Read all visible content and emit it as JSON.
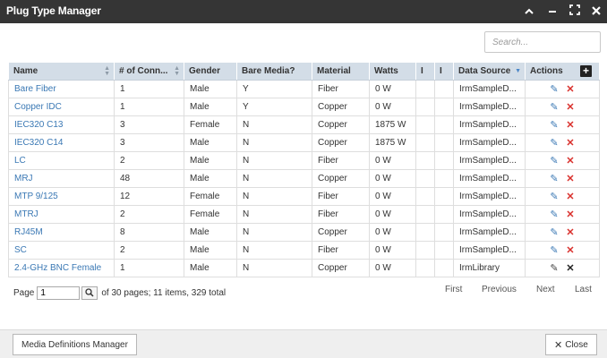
{
  "window": {
    "title": "Plug Type Manager",
    "controls": [
      "chevron-up-icon",
      "minimize-icon",
      "maximize-icon",
      "close-icon"
    ]
  },
  "search": {
    "placeholder": "Search..."
  },
  "table": {
    "columns": [
      "Name",
      "# of Conn...",
      "Gender",
      "Bare Media?",
      "Material",
      "Watts",
      "I",
      "I",
      "Data Source",
      "Actions"
    ],
    "rows": [
      {
        "name": "Bare Fiber",
        "conn": "1",
        "gender": "Male",
        "bare": "Y",
        "material": "Fiber",
        "watts": "0 W",
        "c7": "",
        "c8": "",
        "source": "IrmSampleD..."
      },
      {
        "name": "Copper IDC",
        "conn": "1",
        "gender": "Male",
        "bare": "Y",
        "material": "Copper",
        "watts": "0 W",
        "c7": "",
        "c8": "",
        "source": "IrmSampleD..."
      },
      {
        "name": "IEC320 C13",
        "conn": "3",
        "gender": "Female",
        "bare": "N",
        "material": "Copper",
        "watts": "1875 W",
        "c7": "",
        "c8": "",
        "source": "IrmSampleD..."
      },
      {
        "name": "IEC320 C14",
        "conn": "3",
        "gender": "Male",
        "bare": "N",
        "material": "Copper",
        "watts": "1875 W",
        "c7": "",
        "c8": "",
        "source": "IrmSampleD..."
      },
      {
        "name": "LC",
        "conn": "2",
        "gender": "Male",
        "bare": "N",
        "material": "Fiber",
        "watts": "0 W",
        "c7": "",
        "c8": "",
        "source": "IrmSampleD..."
      },
      {
        "name": "MRJ",
        "conn": "48",
        "gender": "Male",
        "bare": "N",
        "material": "Copper",
        "watts": "0 W",
        "c7": "",
        "c8": "",
        "source": "IrmSampleD..."
      },
      {
        "name": "MTP 9/125",
        "conn": "12",
        "gender": "Female",
        "bare": "N",
        "material": "Fiber",
        "watts": "0 W",
        "c7": "",
        "c8": "",
        "source": "IrmSampleD..."
      },
      {
        "name": "MTRJ",
        "conn": "2",
        "gender": "Female",
        "bare": "N",
        "material": "Fiber",
        "watts": "0 W",
        "c7": "",
        "c8": "",
        "source": "IrmSampleD..."
      },
      {
        "name": "RJ45M",
        "conn": "8",
        "gender": "Male",
        "bare": "N",
        "material": "Copper",
        "watts": "0 W",
        "c7": "",
        "c8": "",
        "source": "IrmSampleD..."
      },
      {
        "name": "SC",
        "conn": "2",
        "gender": "Male",
        "bare": "N",
        "material": "Fiber",
        "watts": "0 W",
        "c7": "",
        "c8": "",
        "source": "IrmSampleD..."
      },
      {
        "name": "2.4-GHz BNC Female",
        "conn": "1",
        "gender": "Male",
        "bare": "N",
        "material": "Copper",
        "watts": "0 W",
        "c7": "",
        "c8": "",
        "source": "IrmLibrary"
      }
    ]
  },
  "pager": {
    "page_label": "Page",
    "page_value": "1",
    "summary": "of 30 pages; 11 items, 329 total",
    "first": "First",
    "previous": "Previous",
    "next": "Next",
    "last": "Last"
  },
  "footer": {
    "media_button": "Media Definitions Manager",
    "close_button": "Close"
  },
  "colors": {
    "titlebar": "#353535",
    "header_bg": "#d3dde7",
    "link": "#3a78b4",
    "delete": "#d9302c"
  }
}
